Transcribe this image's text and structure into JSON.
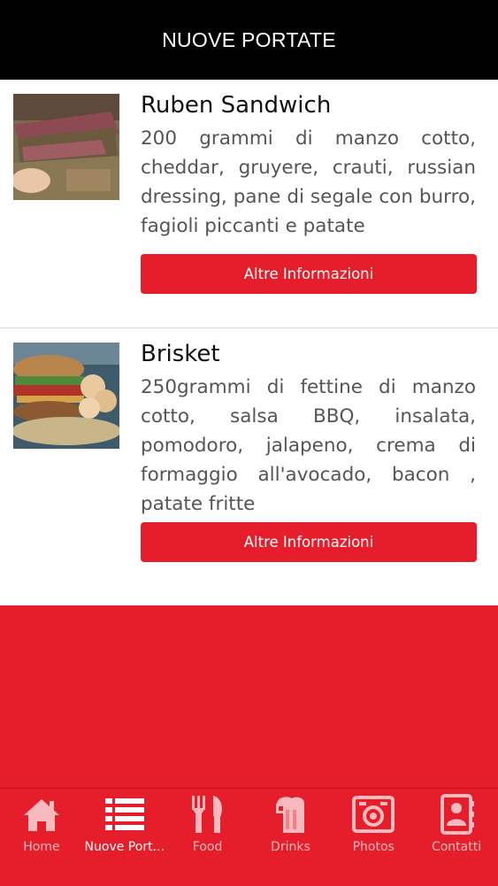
{
  "header": {
    "title": "NUOVE PORTATE"
  },
  "items": [
    {
      "title": "Ruben Sandwich",
      "description": "200 grammi di manzo cotto, cheddar, gruyere, crauti, russian dressing, pane di segale con burro, fagioli piccanti e patate",
      "button_label": "Altre Informazioni"
    },
    {
      "title": "Brisket",
      "description": "250grammi di fettine di manzo cotto, salsa BBQ, insalata, pomodoro, jalapeno, crema di formaggio all'avocado, bacon , patate fritte",
      "button_label": "Altre Informazioni"
    }
  ],
  "tabs": [
    {
      "label": "Home",
      "icon": "home-icon",
      "active": false
    },
    {
      "label": "Nuove Port...",
      "icon": "list-icon",
      "active": true
    },
    {
      "label": "Food",
      "icon": "fork-knife-icon",
      "active": false
    },
    {
      "label": "Drinks",
      "icon": "beer-mug-icon",
      "active": false
    },
    {
      "label": "Photos",
      "icon": "camera-icon",
      "active": false
    },
    {
      "label": "Contatti",
      "icon": "contact-book-icon",
      "active": false
    }
  ],
  "colors": {
    "accent": "#e61e2b",
    "header_bg": "#000000",
    "tab_inactive": "#f6b9bd"
  }
}
